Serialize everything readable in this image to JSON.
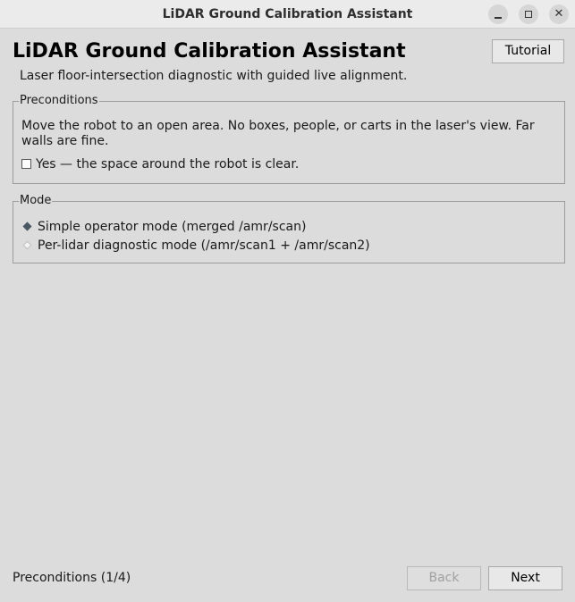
{
  "window": {
    "title": "LiDAR Ground Calibration Assistant",
    "minimize_icon": "minimize-icon",
    "maximize_icon": "maximize-icon",
    "close_icon": "close-icon"
  },
  "header": {
    "title": "LiDAR Ground Calibration Assistant",
    "subtitle": "Laser floor-intersection diagnostic with guided live alignment.",
    "tutorial_label": "Tutorial"
  },
  "preconditions": {
    "legend": "Preconditions",
    "description": "Move the robot to an open area. No boxes, people, or carts in the laser's view. Far walls are fine.",
    "checkbox_label": "Yes — the space around the robot is clear.",
    "checked": false
  },
  "mode": {
    "legend": "Mode",
    "options": [
      {
        "label": "Simple operator mode (merged /amr/scan)",
        "selected": true
      },
      {
        "label": "Per-lidar diagnostic mode (/amr/scan1 + /amr/scan2)",
        "selected": false
      }
    ]
  },
  "footer": {
    "status": "Preconditions (1/4)",
    "back_label": "Back",
    "back_enabled": false,
    "next_label": "Next"
  },
  "colors": {
    "window_bg": "#dcdcdc",
    "titlebar_bg": "#ebebeb",
    "radio_selected": "#4a5664"
  }
}
